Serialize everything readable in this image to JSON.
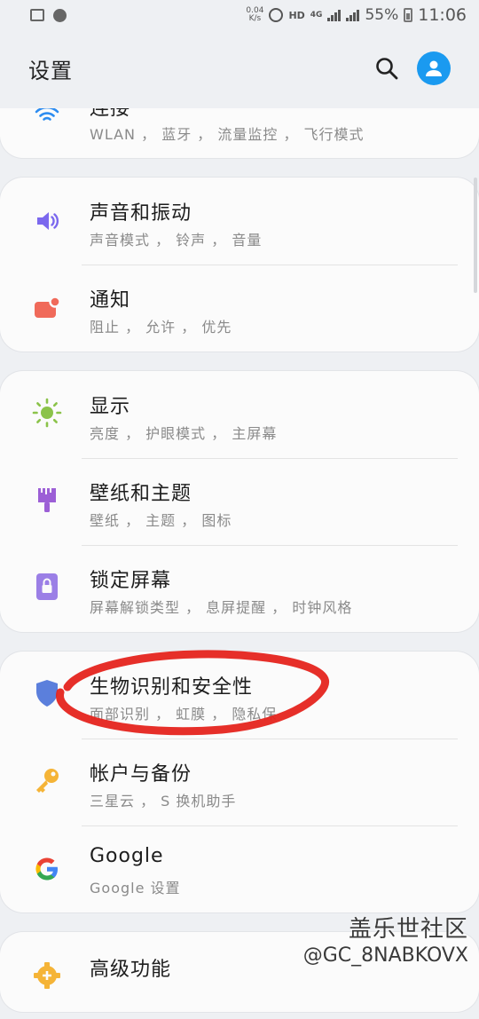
{
  "status": {
    "speed": "0.04\nK/s",
    "hd": "HD",
    "net": "4G",
    "battery": "55%",
    "time": "11:06"
  },
  "header": {
    "title": "设置",
    "search_icon": "search-icon",
    "avatar_icon": "account-icon"
  },
  "groups": [
    {
      "items": [
        {
          "title": "连接",
          "subtitle": "WLAN ， 蓝牙 ， 流量监控 ， 飞行模式",
          "icon": "wifi-icon",
          "color": "#2d8cf0"
        }
      ]
    },
    {
      "items": [
        {
          "title": "声音和振动",
          "subtitle": "声音模式 ， 铃声 ， 音量",
          "icon": "speaker-icon",
          "color": "#7b68ee"
        },
        {
          "title": "通知",
          "subtitle": "阻止 ， 允许 ， 优先",
          "icon": "notification-icon",
          "color": "#f06a5a"
        }
      ]
    },
    {
      "items": [
        {
          "title": "显示",
          "subtitle": "亮度 ， 护眼模式 ， 主屏幕",
          "icon": "brightness-icon",
          "color": "#8bc34a"
        },
        {
          "title": "壁纸和主题",
          "subtitle": "壁纸 ， 主题 ， 图标",
          "icon": "paintbrush-icon",
          "color": "#9c5fd6"
        },
        {
          "title": "锁定屏幕",
          "subtitle": "屏幕解锁类型 ， 息屏提醒 ， 时钟风格",
          "icon": "lock-icon",
          "color": "#9b7fe6"
        }
      ]
    },
    {
      "items": [
        {
          "title": "生物识别和安全性",
          "subtitle": "面部识别 ， 虹膜 ， 隐私保",
          "icon": "shield-icon",
          "color": "#5b7fdc"
        },
        {
          "title": "帐户与备份",
          "subtitle": "三星云 ， S 换机助手",
          "icon": "key-icon",
          "color": "#f5b437"
        },
        {
          "title": "Google",
          "subtitle": "Google 设置",
          "icon": "google-icon",
          "color": "#4285f4"
        }
      ]
    },
    {
      "items": [
        {
          "title": "高级功能",
          "subtitle": "",
          "icon": "gear-plus-icon",
          "color": "#f5b437"
        }
      ]
    }
  ],
  "watermark": {
    "line1": "盖乐世社区",
    "line2": "@GC_8NABKOVX"
  }
}
